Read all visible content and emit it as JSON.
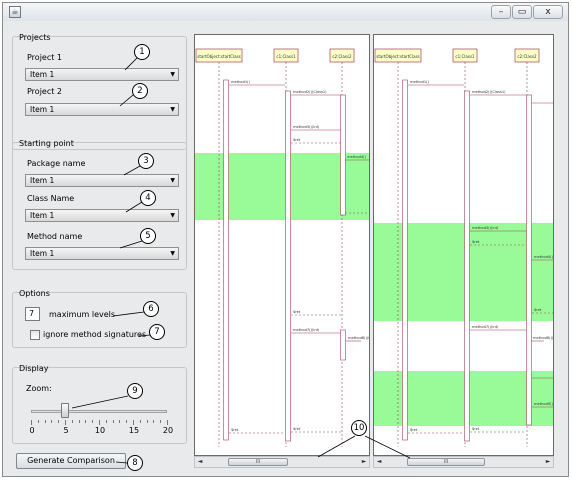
{
  "window": {
    "icon": "java-app-icon",
    "minimize_glyph": "–",
    "maximize_glyph": "▭",
    "close_glyph": "x"
  },
  "projects": {
    "title": "Projects",
    "project1_label": "Project 1",
    "project1_value": "Item 1",
    "project2_label": "Project 2",
    "project2_value": "Item 1"
  },
  "starting_point": {
    "title": "Starting point",
    "package_label": "Package name",
    "package_value": "Item 1",
    "class_label": "Class Name",
    "class_value": "Item 1",
    "method_label": "Method name",
    "method_value": "Item 1"
  },
  "options": {
    "title": "Options",
    "max_levels_value": "7",
    "max_levels_label": "maximum levels",
    "ignore_signatures_label": "ignore method signatures",
    "ignore_signatures_checked": false
  },
  "display": {
    "title": "Display",
    "zoom_label": "Zoom:",
    "zoom_value": 5,
    "zoom_ticks": [
      "0",
      "5",
      "10",
      "15",
      "20"
    ]
  },
  "generate_button": "Generate Comparison",
  "scrollbar_grip": "III",
  "callouts": [
    "1",
    "2",
    "3",
    "4",
    "5",
    "6",
    "7",
    "8",
    "9",
    "10"
  ],
  "diagram": {
    "lifelines": [
      "startObject:startClass",
      "c1:Class1",
      "c2:Class2"
    ],
    "messages": {
      "m1": "method1()",
      "m2": "method2()(Class1)",
      "m3": "method3()(int)",
      "ret": "$ret",
      "m4": "method4()",
      "m5": "method5()",
      "m6": "method6()(int)",
      "m7": "method7()(int)",
      "m8": "method8()(int)",
      "m9": "method9()"
    },
    "colors": {
      "lifeline_box": "#ffffc8",
      "lifeline_border": "#a04060",
      "highlight": "#98fb98",
      "line": "#a04060"
    }
  }
}
